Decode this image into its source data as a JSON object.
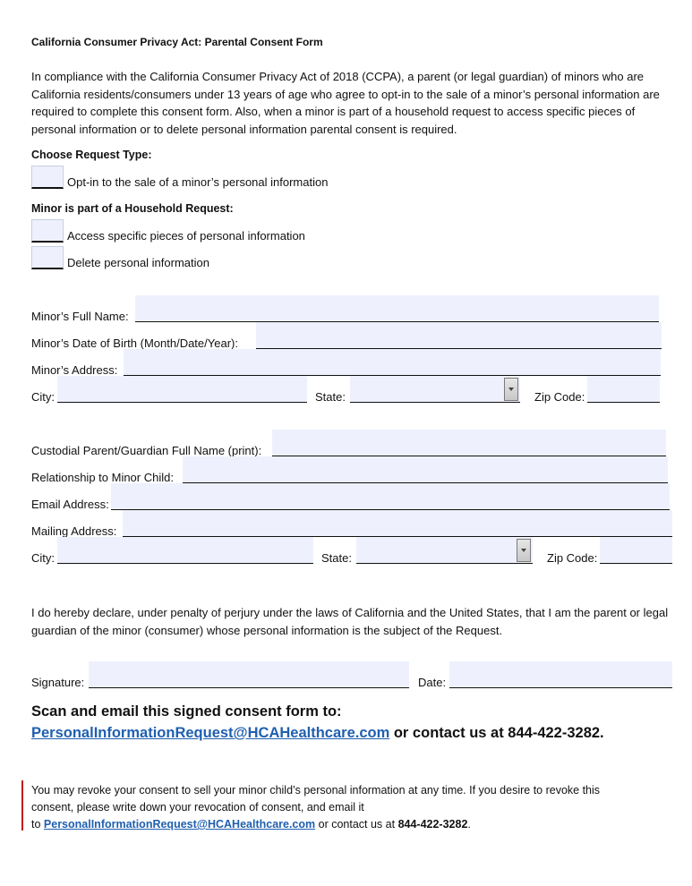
{
  "title": "California Consumer Privacy Act: Parental Consent Form",
  "intro": "In compliance with the California Consumer Privacy Act of 2018 (CCPA), a parent (or legal guardian) of minors who are California residents/consumers under 13 years of age who agree to opt-in to the sale of a minor’s personal information are required to complete this consent form. Also, when a minor is part of a household request to access specific pieces of personal information or to delete personal information parental consent is required.",
  "request_type": {
    "heading": "Choose Request Type:",
    "options": [
      {
        "label": "Opt-in to the sale of a minor’s personal information",
        "checked": false
      }
    ]
  },
  "household": {
    "heading": "Minor is part of a Household Request:",
    "options": [
      {
        "label": "Access specific pieces of personal information",
        "checked": false
      },
      {
        "label": "Delete personal information",
        "checked": false
      }
    ]
  },
  "minor": {
    "full_name_label": "Minor’s Full Name:",
    "dob_label": "Minor’s Date of Birth (Month/Date/Year):",
    "address_label": "Minor’s Address:",
    "city_label": "City:",
    "state_label": "State:",
    "zip_label": "Zip Code:",
    "full_name": "",
    "dob": "",
    "address": "",
    "city": "",
    "state": "",
    "zip": ""
  },
  "guardian": {
    "full_name_label": "Custodial Parent/Guardian Full Name (print):",
    "relationship_label": "Relationship to Minor Child:",
    "email_label": "Email Address:",
    "mailing_label": "Mailing Address:",
    "city_label": "City:",
    "state_label": "State:",
    "zip_label": "Zip Code:",
    "full_name": "",
    "relationship": "",
    "email": "",
    "mailing": "",
    "city": "",
    "state": "",
    "zip": ""
  },
  "declaration": "I do hereby declare, under penalty of perjury under the laws of California and the United States, that I am the parent or legal guardian of the minor (consumer) whose personal information is the subject of the Request.",
  "signature": {
    "signature_label": "Signature:",
    "date_label": "Date:",
    "signature": "",
    "date": ""
  },
  "scan": {
    "line1": "Scan and email this signed consent form to:",
    "email": "PersonalInformationRequest@HCAHealthcare.com",
    "suffix": " or contact us at 844-422-3282."
  },
  "notice": {
    "line1": "You may revoke your consent to sell your minor child’s personal information at any time. If you desire to revoke this",
    "line2": "consent, please write down your revocation of consent, and email it",
    "to": "to ",
    "email": "PersonalInformationRequest@HCAHealthcare.com",
    "middle": " or contact us at ",
    "phone": "844-422-3282",
    "end": "."
  },
  "colors": {
    "field_bg": "#eef1fd",
    "link": "#1f5fb0",
    "notice_bar": "#c0161e"
  }
}
